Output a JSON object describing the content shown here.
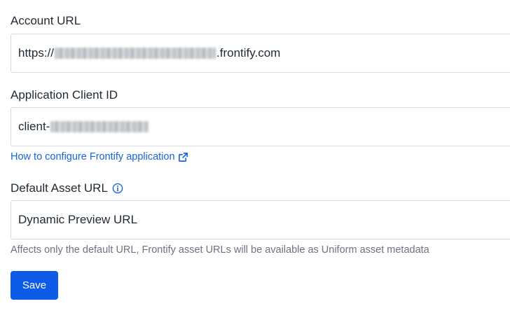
{
  "account_url": {
    "label": "Account URL",
    "value_prefix": "https://",
    "value_suffix": ".frontify.com"
  },
  "client_id": {
    "label": "Application Client ID",
    "value_prefix": "client-"
  },
  "help_link": {
    "text": "How to configure Frontify application",
    "icon": "external-link-icon"
  },
  "default_asset_url": {
    "label": "Default Asset URL",
    "info_icon": "info-icon",
    "value": "Dynamic Preview URL",
    "helper": "Affects only the default URL, Frontify asset URLs will be available as Uniform asset metadata"
  },
  "actions": {
    "save_label": "Save"
  },
  "colors": {
    "primary": "#0c5ce8",
    "link": "#1a64d6",
    "border": "#d6d9de",
    "helper_text": "#6b7280"
  }
}
